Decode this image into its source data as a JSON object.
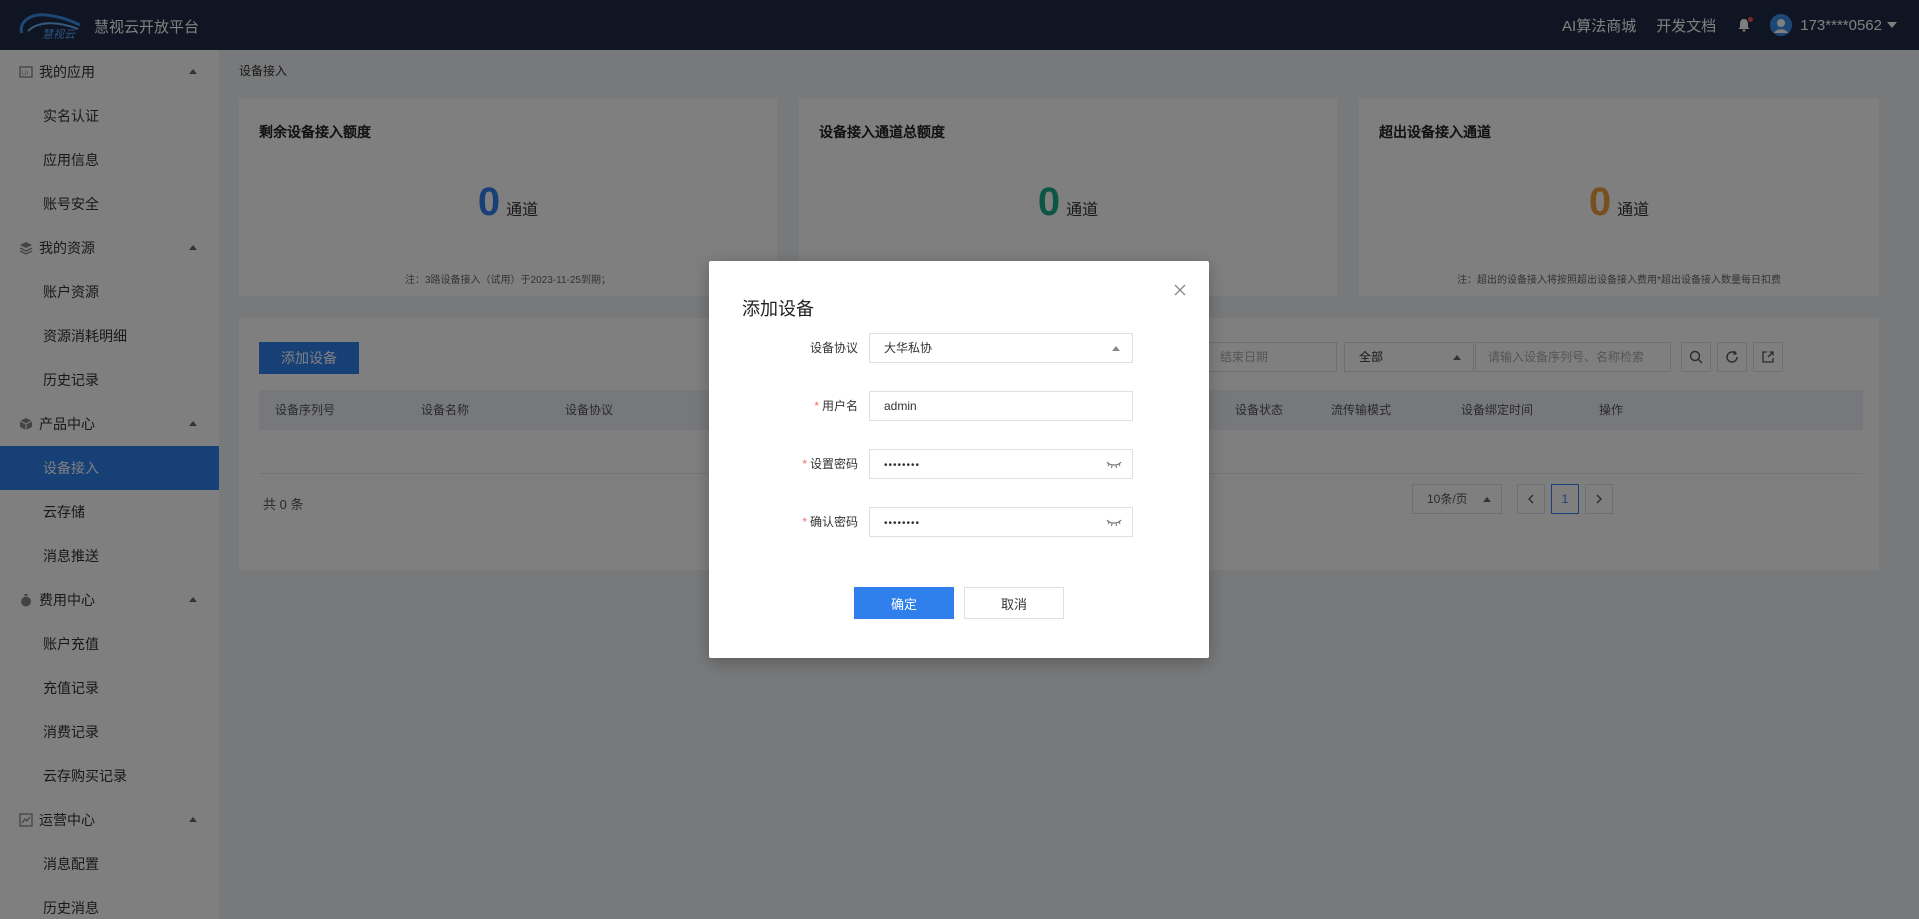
{
  "header": {
    "brand": "慧视云开放平台",
    "nav": [
      "AI算法商城",
      "开发文档"
    ],
    "user": "173****0562"
  },
  "sidebar": {
    "groups": [
      {
        "label": "我的应用",
        "icon": "app-icon",
        "items": [
          "实名认证",
          "应用信息",
          "账号安全"
        ]
      },
      {
        "label": "我的资源",
        "icon": "layers-icon",
        "items": [
          "账户资源",
          "资源消耗明细",
          "历史记录"
        ]
      },
      {
        "label": "产品中心",
        "icon": "cube-icon",
        "items": [
          "设备接入",
          "云存储",
          "消息推送"
        ]
      },
      {
        "label": "费用中心",
        "icon": "money-bag-icon",
        "items": [
          "账户充值",
          "充值记录",
          "消费记录",
          "云存购买记录"
        ]
      },
      {
        "label": "运营中心",
        "icon": "chart-icon",
        "items": [
          "消息配置",
          "历史消息"
        ]
      }
    ],
    "active": "设备接入"
  },
  "breadcrumb": "设备接入",
  "stats": [
    {
      "title": "剩余设备接入额度",
      "value": "0",
      "unit": "通道",
      "color": "#2f80ed",
      "note": "注：3路设备接入（试用）于2023-11-25到期；"
    },
    {
      "title": "设备接入通道总额度",
      "value": "0",
      "unit": "通道",
      "color": "#1aad8c",
      "note": ""
    },
    {
      "title": "超出设备接入通道",
      "value": "0",
      "unit": "通道",
      "color": "#f0a040",
      "note": "注：超出的设备接入将按照超出设备接入费用*超出设备接入数量每日扣费"
    }
  ],
  "list": {
    "add_button": "添加设备",
    "end_date_placeholder": "结束日期",
    "status_filter": "全部",
    "search_placeholder": "请输入设备序列号、名称检索",
    "columns": [
      "设备序列号",
      "设备名称",
      "设备协议",
      "设备状态",
      "流传输模式",
      "设备绑定时间",
      "操作"
    ],
    "total": "共 0 条",
    "page_size": "10条/页",
    "current_page": "1"
  },
  "modal": {
    "title": "添加设备",
    "fields": [
      {
        "label": "设备协议",
        "required": false,
        "value": "大华私协"
      },
      {
        "label": "用户名",
        "required": true,
        "value": "admin"
      },
      {
        "label": "设置密码",
        "required": true,
        "value": "••••••••"
      },
      {
        "label": "确认密码",
        "required": true,
        "value": "••••••••"
      }
    ],
    "ok": "确定",
    "cancel": "取消"
  }
}
